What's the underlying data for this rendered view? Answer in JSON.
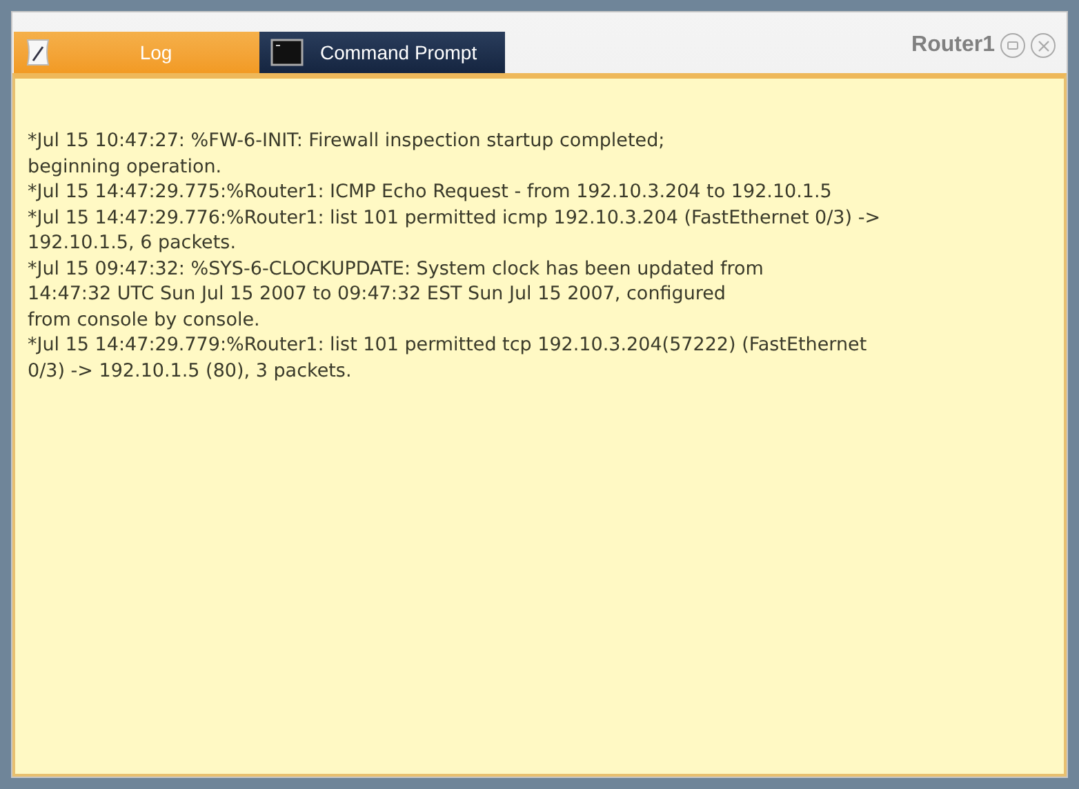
{
  "window": {
    "title": "Router1"
  },
  "tabs": [
    {
      "label": "Log",
      "kind": "log",
      "selected": true
    },
    {
      "label": "Command Prompt",
      "kind": "terminal",
      "selected": false
    }
  ],
  "log": {
    "entries": [
      "*Jul 15 10:47:27: %FW-6-INIT: Firewall inspection startup completed;\nbeginning operation.",
      "*Jul 15 14:47:29.775:%Router1: ICMP Echo Request - from 192.10.3.204 to 192.10.1.5",
      "*Jul 15 14:47:29.776:%Router1: list 101 permitted icmp 192.10.3.204 (FastEthernet 0/3) ->\n192.10.1.5, 6 packets.",
      "*Jul 15 09:47:32: %SYS-6-CLOCKUPDATE: System clock has been updated from\n14:47:32 UTC Sun Jul 15 2007 to 09:47:32 EST Sun Jul 15 2007, configured\nfrom console by console.",
      "*Jul 15 14:47:29.779:%Router1: list 101 permitted tcp 192.10.3.204(57222) (FastEthernet\n0/3) -> 192.10.1.5 (80), 3 packets."
    ]
  }
}
